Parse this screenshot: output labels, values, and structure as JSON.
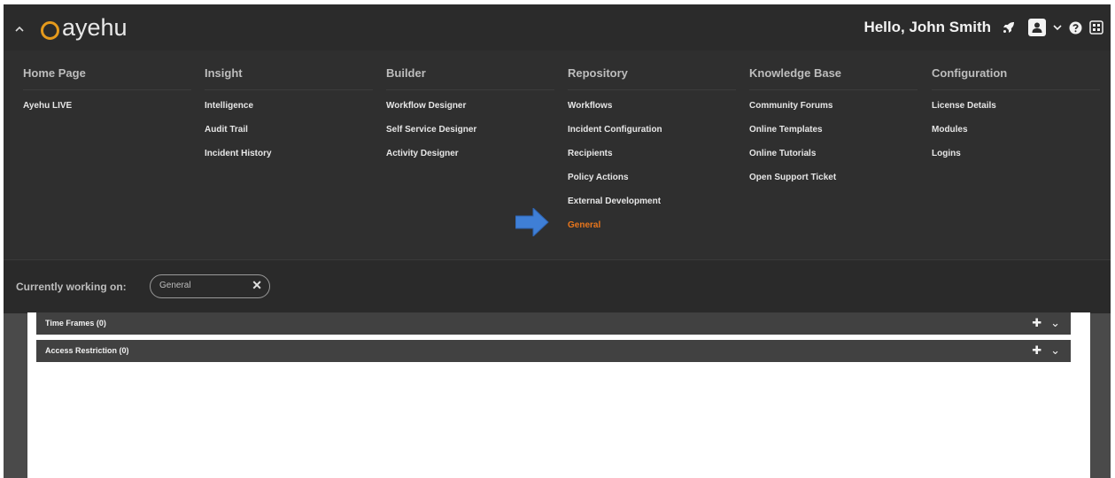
{
  "header": {
    "logo_text": "ayehu",
    "greeting": "Hello, John Smith",
    "icons": [
      "chevron-up-icon",
      "rocket-icon",
      "user-icon",
      "chevron-down-icon",
      "help-icon",
      "layout-icon"
    ]
  },
  "menu": {
    "columns": [
      {
        "heading": "Home Page",
        "items": [
          "Ayehu LIVE"
        ]
      },
      {
        "heading": "Insight",
        "items": [
          "Intelligence",
          "Audit Trail",
          "Incident History"
        ]
      },
      {
        "heading": "Builder",
        "items": [
          "Workflow Designer",
          "Self Service Designer",
          "Activity Designer"
        ]
      },
      {
        "heading": "Repository",
        "items": [
          "Workflows",
          "Incident Configuration",
          "Recipients",
          "Policy Actions",
          "External Development",
          "General"
        ]
      },
      {
        "heading": "Knowledge Base",
        "items": [
          "Community Forums",
          "Online Templates",
          "Online Tutorials",
          "Open Support Ticket"
        ]
      },
      {
        "heading": "Configuration",
        "items": [
          "License Details",
          "Modules",
          "Logins"
        ]
      }
    ],
    "active_item": "General"
  },
  "workbar": {
    "label": "Currently working on:",
    "chip": "General",
    "close": "✕"
  },
  "panels": [
    {
      "title": "Time Frames (0)",
      "add": "✚",
      "toggle": "⌄"
    },
    {
      "title": "Access Restriction (0)",
      "add": "✚",
      "toggle": "⌄"
    }
  ],
  "colors": {
    "accent": "#e8761c",
    "logo_ring": "#e59a1c",
    "header_bg": "#2b2b2b",
    "menu_bg": "#2f2f2f",
    "panel_bg": "#414141",
    "arrow": "#3f7fd6"
  }
}
